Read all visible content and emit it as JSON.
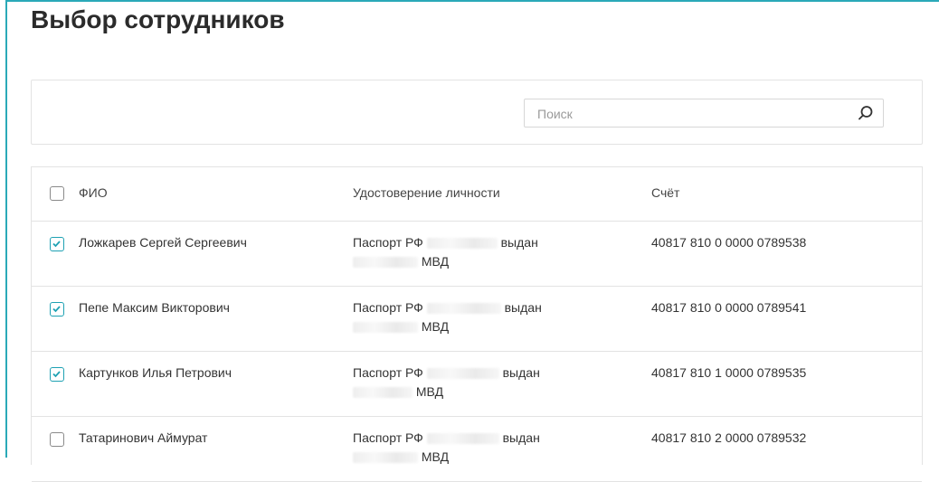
{
  "page": {
    "title": "Выбор сотрудников"
  },
  "search": {
    "placeholder": "Поиск",
    "value": ""
  },
  "table": {
    "columns": {
      "name": "ФИО",
      "document": "Удостоверение личности",
      "account": "Счёт"
    },
    "rows": [
      {
        "name": "Ложкарев Сергей Сергеевич",
        "doc_prefix": "Паспорт РФ",
        "doc_issued": "выдан",
        "doc_authority": "МВД",
        "account": "40817 810 0 0000 0789538",
        "checked": true
      },
      {
        "name": "Пепе Максим Викторович",
        "doc_prefix": "Паспорт РФ",
        "doc_issued": "выдан",
        "doc_authority": "МВД",
        "account": "40817 810 0 0000 0789541",
        "checked": true
      },
      {
        "name": "Картунков Илья Петрович",
        "doc_prefix": "Паспорт РФ",
        "doc_issued": "выдан",
        "doc_authority": "МВД",
        "account": "40817 810 1 0000 0789535",
        "checked": true
      },
      {
        "name": "Татаринович Аймурат",
        "doc_prefix": "Паспорт РФ",
        "doc_issued": "выдан",
        "doc_authority": "МВД",
        "account": "40817 810 2 0000 0789532",
        "checked": false
      }
    ]
  },
  "colors": {
    "accent": "#1ea1b3",
    "frame": "#2aa9b8",
    "border": "#e3e3e3"
  },
  "icons": {
    "search": "magnifier-icon",
    "check": "checkmark-icon"
  }
}
